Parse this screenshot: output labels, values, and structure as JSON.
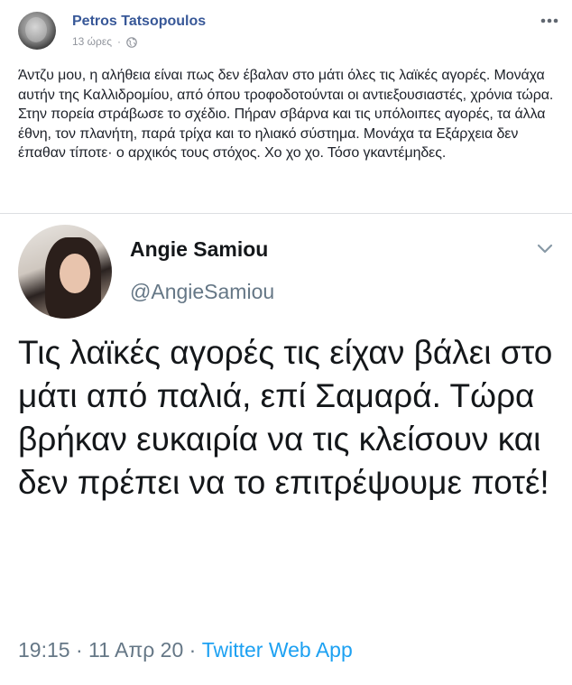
{
  "post": {
    "author": "Petros Tatsopoulos",
    "timestamp": "13 ώρες",
    "separator": "·",
    "privacy_icon": "globe-icon",
    "menu_icon": "more-horizontal-icon",
    "text": "Άντζυ μου, η αλήθεια είναι πως δεν έβαλαν στο μάτι όλες τις λαϊκές αγορές. Μονάχα αυτήν της Καλλιδρομίου, από όπου τροφοδοτούνται οι αντιεξουσιαστές, χρόνια τώρα. Στην πορεία στράβωσε το σχέδιο. Πήραν σβάρνα και τις υπόλοιπες αγορές, τα άλλα έθνη, τον πλανήτη, παρά τρίχα και το ηλιακό σύστημα. Μονάχα τα Εξάρχεια δεν έπαθαν τίποτε· ο αρχικός τους στόχος. Χο χο χο. Τόσο γκαντέμηδες."
  },
  "tweet": {
    "name": "Angie Samiou",
    "handle": "@AngieSamiou",
    "menu_icon": "chevron-down-icon",
    "text": "Τις λαϊκές αγορές τις είχαν βάλει στο μάτι από παλιά, επί Σαμαρά. Τώρα βρήκαν ευκαιρία να τις κλείσουν και δεν πρέπει να το επιτρέψουμε ποτέ!",
    "time": "19:15 · 11 Απρ 20 · ",
    "source": "Twitter Web App"
  },
  "colors": {
    "fb_link": "#385898",
    "fb_meta": "#90949c",
    "fb_text": "#1d2129",
    "tw_text": "#14171a",
    "tw_meta": "#657786",
    "tw_link": "#1da1f2"
  }
}
